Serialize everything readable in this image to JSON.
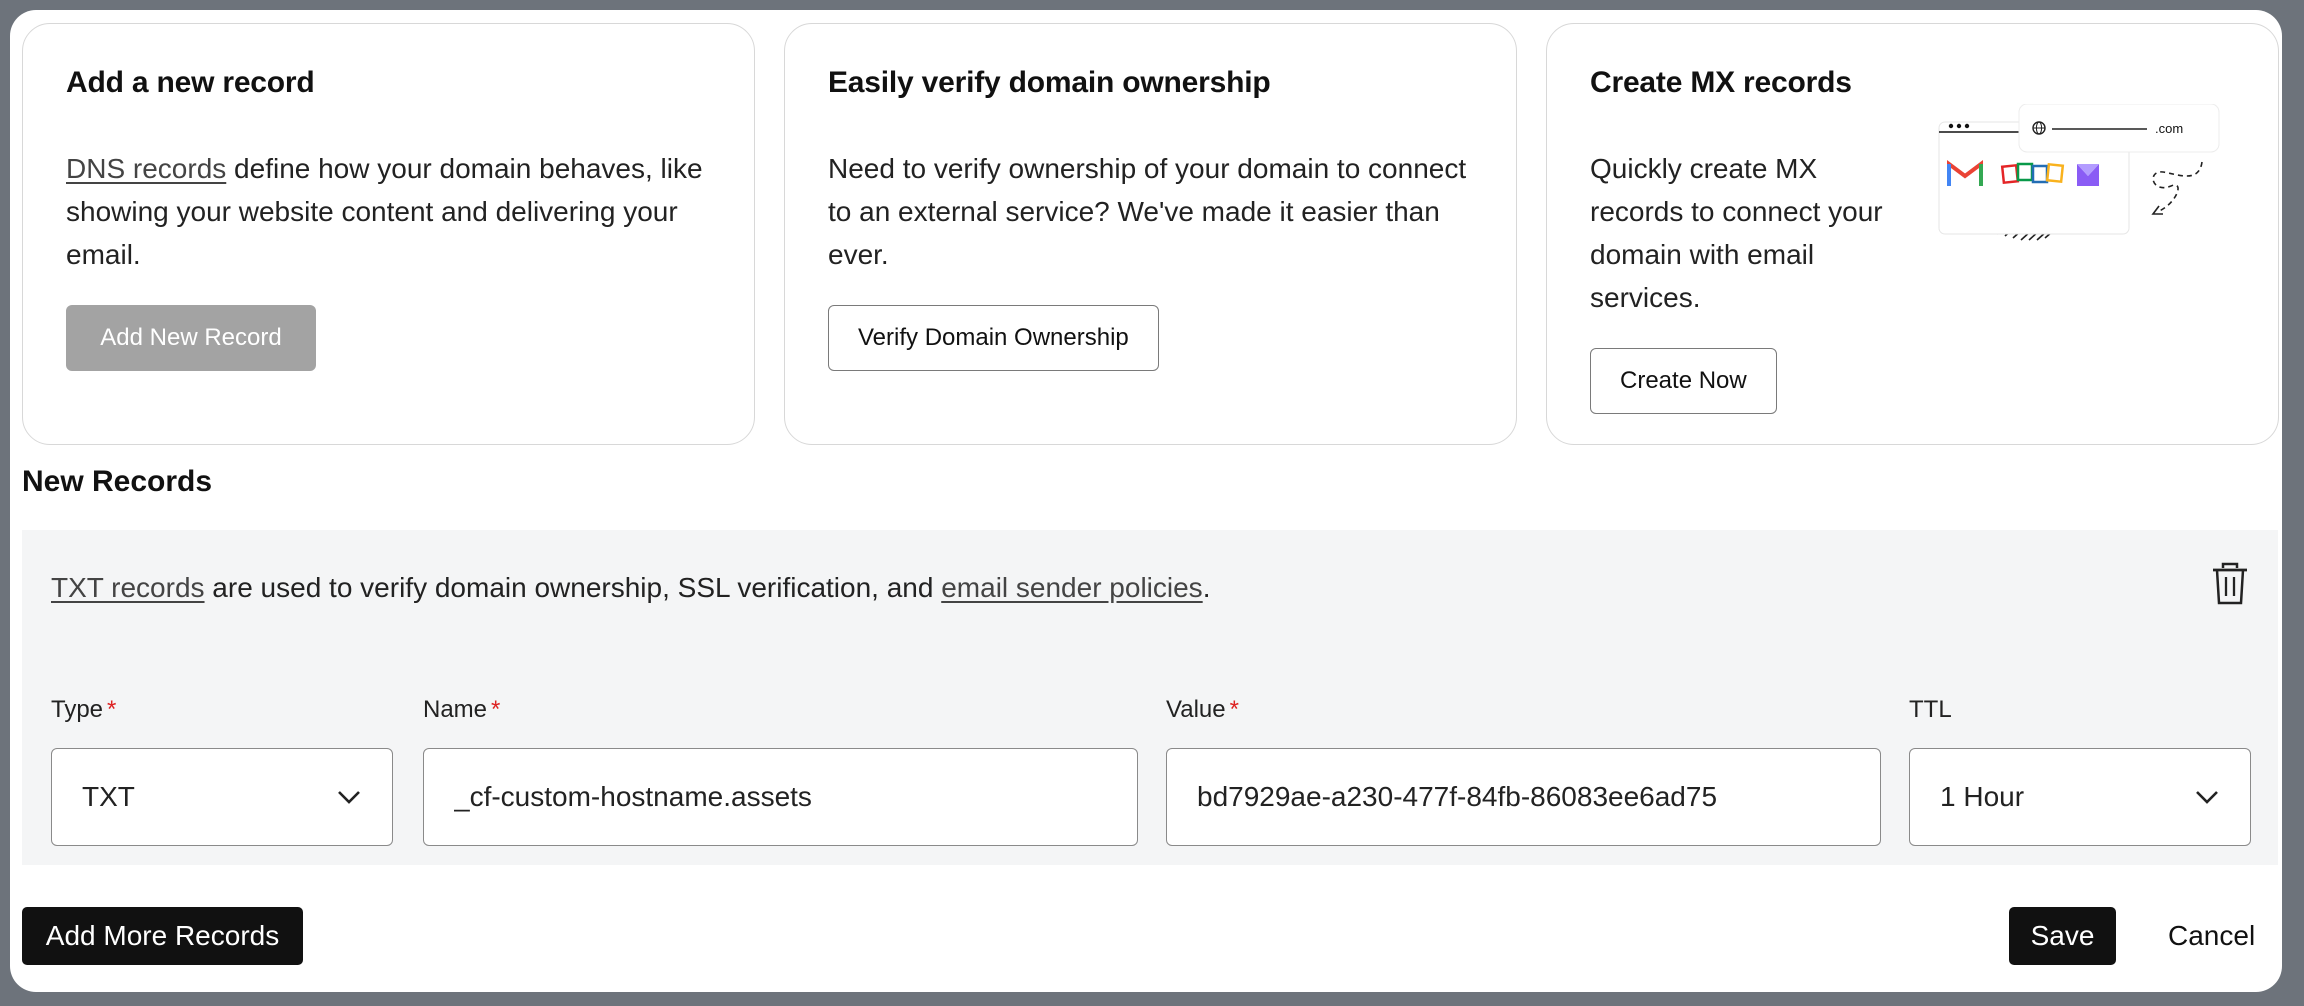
{
  "cards": {
    "add": {
      "title": "Add a new record",
      "link": "DNS records",
      "text": " define how your domain behaves, like showing your website content and delivering your email.",
      "button": "Add New Record"
    },
    "verify": {
      "title": "Easily verify domain ownership",
      "text": "Need to verify ownership of your domain to connect to an external service? We've made it easier than ever.",
      "button": "Verify Domain Ownership"
    },
    "mx": {
      "title": "Create MX records",
      "text": "Quickly create MX records to connect your domain with email services.",
      "button": "Create Now",
      "illustration_text": ".com"
    }
  },
  "new_records": {
    "title": "New Records",
    "note_link1": "TXT records",
    "note_mid": " are used to verify domain ownership, SSL verification, and ",
    "note_link2": "email sender policies",
    "note_end": ".",
    "fields": {
      "type": {
        "label": "Type",
        "required": "*",
        "value": "TXT"
      },
      "name": {
        "label": "Name",
        "required": "*",
        "value": "_cf-custom-hostname.assets"
      },
      "value": {
        "label": "Value",
        "required": "*",
        "value": "bd7929ae-a230-477f-84fb-86083ee6ad75"
      },
      "ttl": {
        "label": "TTL",
        "value": "1 Hour"
      }
    }
  },
  "footer": {
    "add_more": "Add More Records",
    "save": "Save",
    "cancel": "Cancel"
  },
  "colors": {
    "primary_dark": "#111111",
    "disabled_button": "#a3a3a3",
    "panel_bg": "#f4f5f6",
    "required": "#dd2222"
  }
}
